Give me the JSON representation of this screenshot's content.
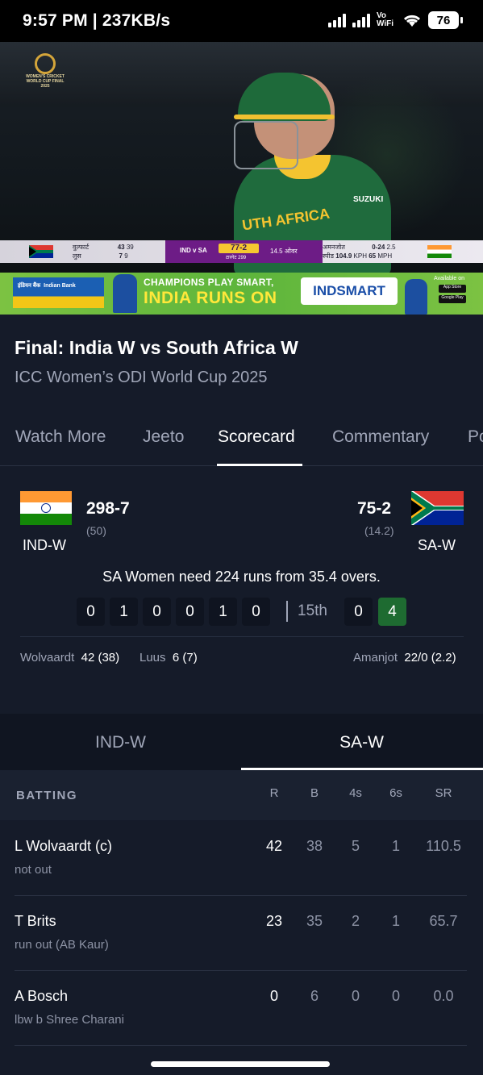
{
  "status_bar": {
    "time": "9:57 PM | 237KB/s",
    "vowifi": "Vo WiFi",
    "battery": "76"
  },
  "video": {
    "event_logo_text": "WOMEN'S CRICKET WORLD CUP FINAL 2025",
    "jersey_text": "UTH AFRICA",
    "sponsor_text": "SUZUKI",
    "score_strip": {
      "batter1_name": "वुल्फार्ट",
      "batter1_runs": "43",
      "batter1_balls": "39",
      "batter2_name": "लुस",
      "batter2_runs": "7",
      "batter2_balls": "9",
      "match_tag": "IND v SA",
      "score": "77-2",
      "target": "टारगेट 299",
      "overs": "14.5 ओवर",
      "bowler_name": "अमनजोत",
      "bowler_figures": "0-24",
      "bowler_overs": "2.5",
      "speed_label": "स्पीड",
      "speed_kph": "104.9",
      "speed_kph_unit": "KPH",
      "speed_mph": "65",
      "speed_mph_unit": "MPH"
    }
  },
  "ad": {
    "bank_hindi": "इंडियन बैंक",
    "bank_name": "Indian Bank",
    "headline1": "CHAMPIONS PLAY SMART,",
    "headline2": "INDIA RUNS ON",
    "brand": "INDSMART",
    "available_on": "Available on",
    "store1": "App Store",
    "store2": "Google Play"
  },
  "match": {
    "title": "Final: India W vs South Africa W",
    "subtitle": "ICC Women’s ODI World Cup 2025"
  },
  "tabs": [
    {
      "label": "Watch More"
    },
    {
      "label": "Jeeto"
    },
    {
      "label": "Scorecard"
    },
    {
      "label": "Commentary"
    },
    {
      "label": "Po"
    }
  ],
  "summary": {
    "team1": {
      "name": "IND-W",
      "score": "298-7",
      "overs": "(50)"
    },
    "team2": {
      "name": "SA-W",
      "score": "75-2",
      "overs": "(14.2)"
    },
    "need_text": "SA Women need 224 runs from 35.4 overs.",
    "prev_over_balls": [
      "0",
      "1",
      "0",
      "0",
      "1",
      "0"
    ],
    "current_over_label": "15th",
    "current_over_balls": [
      "0",
      "4"
    ],
    "batter1": {
      "name": "Wolvaardt",
      "stat": "42 (38)"
    },
    "batter2": {
      "name": "Luus",
      "stat": "6 (7)"
    },
    "bowler": {
      "name": "Amanjot",
      "stat": "22/0 (2.2)"
    }
  },
  "team_toggle": {
    "left": "IND-W",
    "right": "SA-W"
  },
  "batting": {
    "label": "BATTING",
    "columns": [
      "R",
      "B",
      "4s",
      "6s",
      "SR"
    ],
    "rows": [
      {
        "name": "L Wolvaardt (c)",
        "dismissal": "not out",
        "r": "42",
        "b": "38",
        "fours": "5",
        "sixes": "1",
        "sr": "110.5"
      },
      {
        "name": "T Brits",
        "dismissal": "run out (AB Kaur)",
        "r": "23",
        "b": "35",
        "fours": "2",
        "sixes": "1",
        "sr": "65.7"
      },
      {
        "name": "A Bosch",
        "dismissal": "lbw b Shree Charani",
        "r": "0",
        "b": "6",
        "fours": "0",
        "sixes": "0",
        "sr": "0.0"
      }
    ]
  }
}
